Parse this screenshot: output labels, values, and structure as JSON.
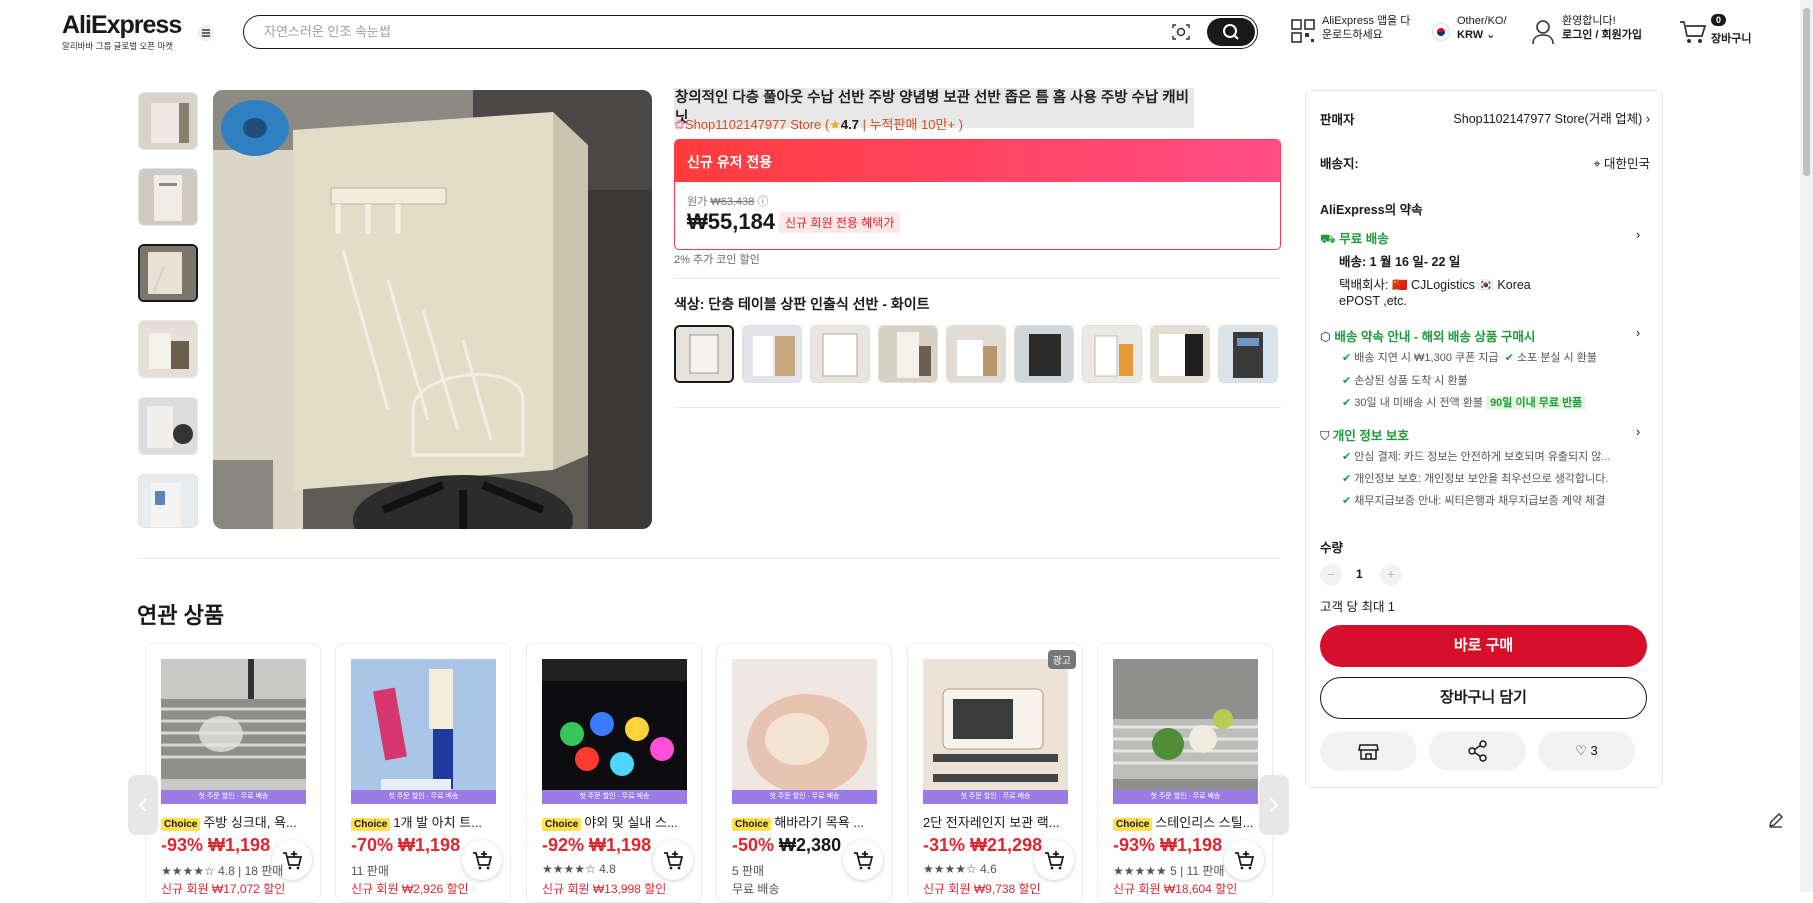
{
  "header": {
    "logo": "AliExpress",
    "logo_sub": "알리바바 그룹 글로벌 오픈 마켓",
    "search_placeholder": "자연스러운 인조 속눈썹",
    "app_line1": "AliExpress 앱을 다",
    "app_line2": "운로드하세요",
    "locale_line1": "Other/KO/",
    "locale_line2": "KRW",
    "user_line1": "환영합니다!",
    "user_line2": "로그인 / 회원가입",
    "cart_count": "0",
    "cart_label": "장바구니"
  },
  "product": {
    "title": "창의적인 다층 풀아웃 수납 선반 주방 양념병 보관 선반 좁은 틈 홈 사용 주방 수납 캐비닛",
    "store": "Shop1102147977 Store",
    "rating": "4.7",
    "sold": "누적판매 10만+",
    "promo_header": "신규 유저 전용",
    "original_label": "원가",
    "original_price": "₩63,438",
    "price": "₩55,184",
    "price_badge": "신규 회원 전용 혜택가",
    "coin_note": "2% 추가 코인 할인",
    "color_label": "색상: 단층 테이블 상판 인출식 선반 - 화이트",
    "selected_thumb": 3,
    "swatch_count": 9
  },
  "related": {
    "title": "연관 상품",
    "strip": "첫 주문 할인 · 무료 배송",
    "items": [
      {
        "choice": "Choice",
        "name": "주방 싱크대, 욕...",
        "discount": "-93%",
        "price": "₩1,198",
        "meta": "★★★★☆ 4.8 | 18 판매",
        "coupon": "신규 회원 ₩17,072 할인"
      },
      {
        "choice": "Choice",
        "name": "1개 발 아치 트...",
        "discount": "-70%",
        "price": "₩1,198",
        "meta": "11 판매",
        "coupon": "신규 회원 ₩2,926 할인"
      },
      {
        "choice": "Choice",
        "name": "야외 및 실내 스...",
        "discount": "-92%",
        "price": "₩1,198",
        "meta": "★★★★☆ 4.8",
        "coupon": "신규 회원 ₩13,998 할인"
      },
      {
        "choice": "Choice",
        "name": "해바라기 목욕 ...",
        "discount": "-50%",
        "price": "₩2,380",
        "meta": "5 판매",
        "coupon": "무료 배송"
      },
      {
        "choice": "",
        "name": "2단 전자레인지 보관 랙...",
        "discount": "-31%",
        "price": "₩21,298",
        "meta": "★★★★☆ 4.6",
        "coupon": "신규 회원 ₩9,738 할인",
        "ad": "광고"
      },
      {
        "choice": "Choice",
        "name": "스테인리스 스틸...",
        "discount": "-93%",
        "price": "₩1,198",
        "meta": "★★★★★ 5 | 11 판매",
        "coupon": "신규 회원 ₩18,604 할인"
      }
    ]
  },
  "sidebar": {
    "seller_label": "판매자",
    "seller_value": "Shop1102147977 Store(거래 업체)",
    "ship_label": "배송지:",
    "ship_value": "대한민국",
    "promise_title": "AliExpress의 약속",
    "free_ship": "무료 배송",
    "delivery": "배송: 1 월 16 일- 22 일",
    "courier_line1": "택배회사: 🇨🇳 CJLogistics 🇰🇷 Korea",
    "courier_line2": "ePOST ,etc.",
    "guarantee_title": "배송 약속 안내 - 해외 배송 상품 구매시",
    "g1": "배송 지연 시 ₩1,300 쿠폰 지급",
    "g1b": "소포 분실 시 환불",
    "g2": "손상된 상품 도착 시 환불",
    "g3": "30일 내 미배송 시 전액 환불",
    "g3_badge": "90일 이내 무료 반품",
    "privacy_title": "개인 정보 보호",
    "p1": "안심 결제: 카드 정보는 안전하게 보호되며 유출되지 않...",
    "p2": "개인정보 보호: 개인정보 보안을 최우선으로 생각합니다.",
    "p3": "채무지급보증 안내: 씨티은행과 채무지급보증 계약 체결",
    "qty_label": "수량",
    "qty_value": "1",
    "qty_limit": "고객 당 최대 1",
    "buy_now": "바로 구매",
    "add_cart": "장바구니 담기",
    "wish_count": "3"
  },
  "colors": {
    "brand_red": "#d6102a",
    "green": "#1e9a3a",
    "promo_pink": "#ff4d87"
  }
}
